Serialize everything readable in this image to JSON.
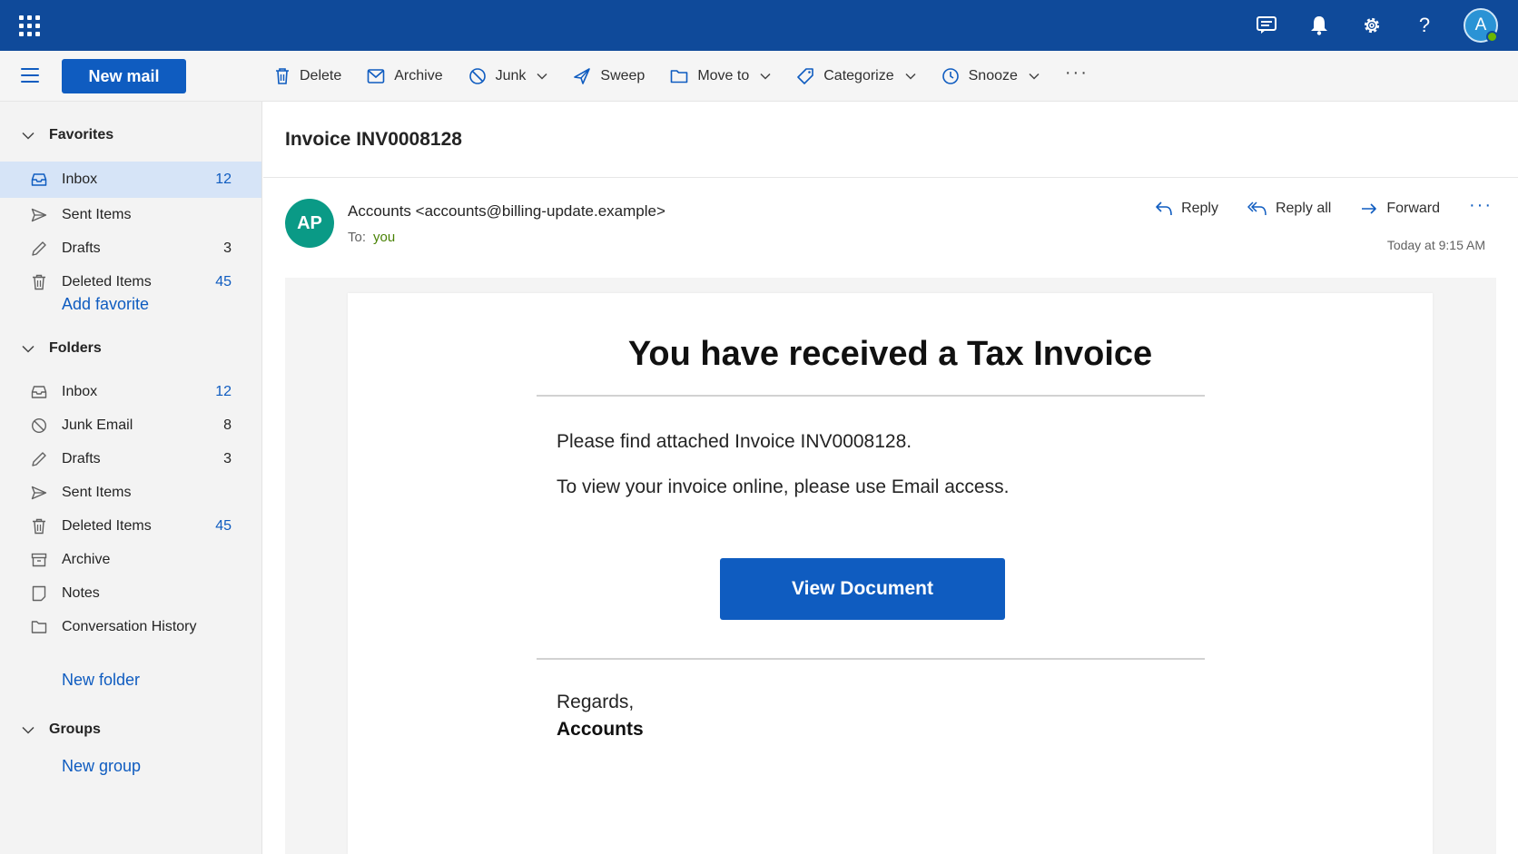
{
  "topbar": {
    "avatar_initial": "A",
    "icons": [
      "feedback-icon",
      "bell-icon",
      "gear-icon",
      "help-icon"
    ],
    "help_glyph": "?"
  },
  "commandbar": {
    "new_mail": "New mail",
    "tools": [
      {
        "label": "Delete",
        "icon": "trash-icon"
      },
      {
        "label": "Archive",
        "icon": "archive-icon"
      },
      {
        "label": "Junk",
        "icon": "junk-icon",
        "dropdown": true
      },
      {
        "label": "Sweep",
        "icon": "sweep-icon"
      },
      {
        "label": "Move to",
        "icon": "folder-icon",
        "dropdown": true
      },
      {
        "label": "Categorize",
        "icon": "tag-icon",
        "dropdown": true
      },
      {
        "label": "Snooze",
        "icon": "clock-icon",
        "dropdown": true
      }
    ],
    "more": "···"
  },
  "sidebar": {
    "favorites": {
      "title": "Favorites",
      "items": [
        {
          "label": "Inbox",
          "count": "12",
          "icon": "inbox-icon"
        },
        {
          "label": "Sent Items",
          "count": "",
          "icon": "send-icon"
        },
        {
          "label": "Drafts",
          "count": "3",
          "icon": "pencil-icon"
        },
        {
          "label": "Deleted Items",
          "count": "45",
          "icon": "trash-icon"
        }
      ],
      "add": "Add favorite"
    },
    "folders": {
      "title": "Folders",
      "items": [
        {
          "label": "Inbox",
          "count": "12",
          "icon": "inbox-icon"
        },
        {
          "label": "Junk Email",
          "count": "8",
          "icon": "junk-icon"
        },
        {
          "label": "Drafts",
          "count": "3",
          "icon": "pencil-icon"
        },
        {
          "label": "Sent Items",
          "count": "",
          "icon": "send-icon"
        },
        {
          "label": "Deleted Items",
          "count": "45",
          "icon": "trash-icon"
        },
        {
          "label": "Archive",
          "count": "",
          "icon": "archive-icon"
        },
        {
          "label": "Notes",
          "count": "",
          "icon": "note-icon"
        },
        {
          "label": "Conversation History",
          "count": "",
          "icon": "folder-icon"
        }
      ],
      "add": "New folder"
    },
    "groups": {
      "title": "Groups",
      "add": "New group"
    }
  },
  "message": {
    "subject": "Invoice INV0008128",
    "sender_initials": "AP",
    "sender": "Accounts <accounts@billing-update.example>",
    "to_label": "To:",
    "to_value": "you",
    "actions": {
      "reply": "Reply",
      "reply_all": "Reply all",
      "forward": "Forward",
      "more": "···"
    },
    "timestamp": "Today at 9:15 AM",
    "body": {
      "headline": "You have received a Tax Invoice",
      "line1": "Please find attached Invoice INV0008128.",
      "line2": "To view your invoice online, please use Email access.",
      "button": "View Document",
      "regards": "Regards,",
      "signature": "Accounts"
    }
  },
  "colors": {
    "topbar": "#0f4a9a",
    "accent": "#0f5cc0",
    "selected": "#d6e4f7",
    "sender_avatar": "#0a9a86",
    "recipient": "#498205"
  }
}
